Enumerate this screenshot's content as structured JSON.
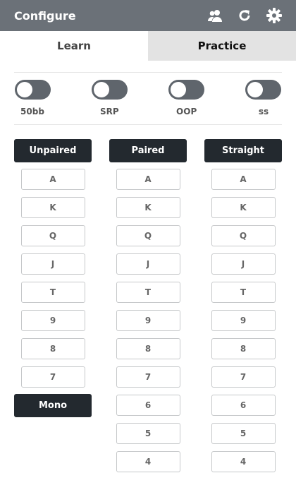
{
  "header": {
    "title": "Configure",
    "icons": [
      "users-icon",
      "refresh-icon",
      "gear-icon"
    ]
  },
  "tabs": {
    "learn": "Learn",
    "practice": "Practice"
  },
  "toggles": [
    {
      "label": "50bb",
      "on": false
    },
    {
      "label": "SRP",
      "on": false
    },
    {
      "label": "OOP",
      "on": false
    },
    {
      "label": "ss",
      "on": false
    }
  ],
  "columns": {
    "unpaired": {
      "title": "Unpaired",
      "ranks": [
        "A",
        "K",
        "Q",
        "J",
        "T",
        "9",
        "8",
        "7"
      ],
      "extra": "Mono"
    },
    "paired": {
      "title": "Paired",
      "ranks": [
        "A",
        "K",
        "Q",
        "J",
        "T",
        "9",
        "8",
        "7",
        "6",
        "5",
        "4"
      ]
    },
    "straight": {
      "title": "Straight",
      "ranks": [
        "A",
        "K",
        "Q",
        "J",
        "T",
        "9",
        "8",
        "7",
        "6",
        "5",
        "4"
      ]
    }
  },
  "colors": {
    "header_bg": "#6b7178",
    "dark_button": "#23292f",
    "toggle_off": "#5f656c"
  }
}
